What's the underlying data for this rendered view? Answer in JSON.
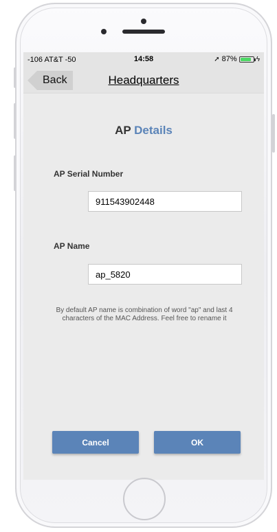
{
  "status_bar": {
    "carrier": "-106 AT&T -50",
    "time": "14:58",
    "battery_text": "87%",
    "battery_level": 0.87,
    "battery_color": "#4cd964",
    "location_icon": "location-arrow-icon",
    "charging_icon": "bolt-icon"
  },
  "nav": {
    "back_label": "Back",
    "title": "Headquarters"
  },
  "page": {
    "title_part1": "AP",
    "title_part2": "Details",
    "accent_color": "#5b84b8"
  },
  "form": {
    "serial_label": "AP Serial Number",
    "serial_value": "911543902448",
    "name_label": "AP Name",
    "name_value": "ap_5820",
    "hint": "By default AP name is combination of word \"ap\" and last 4 characters of the MAC Address. Feel free to rename it"
  },
  "actions": {
    "cancel_label": "Cancel",
    "ok_label": "OK"
  }
}
